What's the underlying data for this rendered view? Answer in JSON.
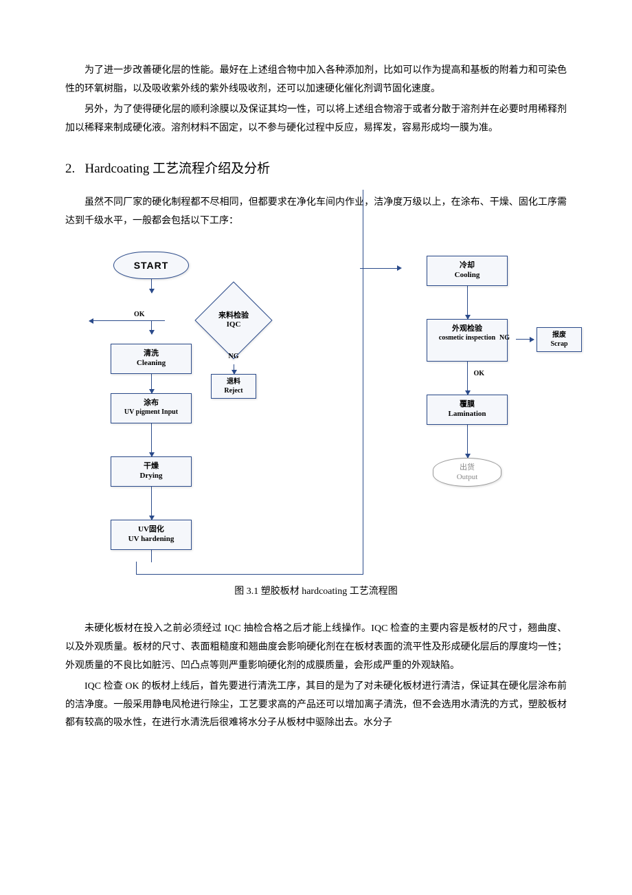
{
  "paragraphs": {
    "p1": "为了进一步改善硬化层的性能。最好在上述组合物中加入各种添加剂，比如可以作为提高和基板的附着力和可染色性的环氧树脂，以及吸收紫外线的紫外线吸收剂，还可以加速硬化催化剂调节固化速度。",
    "p2": "另外，为了使得硬化层的顺利涂膜以及保证其均一性，可以将上述组合物溶于或者分散于溶剂并在必要时用稀释剂加以稀释来制成硬化液。溶剂材料不固定，以不参与硬化过程中反应，易挥发，容易形成均一膜为准。",
    "p3": "虽然不同厂家的硬化制程都不尽相同，但都要求在净化车间内作业，洁净度万级以上，在涂布、干燥、固化工序需达到千级水平，一般都会包括以下工序：",
    "p4": "未硬化板材在投入之前必须经过 IQC 抽检合格之后才能上线操作。IQC 检查的主要内容是板材的尺寸，翘曲度、以及外观质量。板材的尺寸、表面粗糙度和翘曲度会影响硬化剂在在板材表面的流平性及形成硬化层后的厚度均一性；外观质量的不良比如脏污、凹凸点等则严重影响硬化剂的成膜质量，会形成严重的外观缺陷。",
    "p5": "IQC 检查 OK 的板材上线后，首先要进行清洗工序，其目的是为了对未硬化板材进行清洁，保证其在硬化层涂布前的洁净度。一般采用静电风枪进行除尘，工艺要求高的产品还可以增加离子清洗，但不会选用水清洗的方式，塑胶板材都有较高的吸水性，在进行水清洗后很难将水分子从板材中驱除出去。水分子"
  },
  "heading": {
    "num": "2.",
    "title": "Hardcoating 工艺流程介绍及分析"
  },
  "caption": "图 3.1    塑胶板材 hardcoating 工艺流程图",
  "flow": {
    "start": "START",
    "iqc": {
      "cn": "来料检验",
      "en": "IQC"
    },
    "ok": "OK",
    "ng": "NG",
    "reject": {
      "cn": "退料",
      "en": "Reject"
    },
    "cleaning": {
      "cn": "清洗",
      "en": "Cleaning"
    },
    "pigment": {
      "cn": "涂布",
      "en": "UV pigment Input"
    },
    "drying": {
      "cn": "干燥",
      "en": "Drying"
    },
    "uvharden": {
      "cn": "UV固化",
      "en": "UV hardening"
    },
    "cooling": {
      "cn": "冷却",
      "en": "Cooling"
    },
    "cosmetic": {
      "cn": "外观检验",
      "en": "cosmetic inspection"
    },
    "scrap": {
      "cn": "报废",
      "en": "Scrap"
    },
    "lamination": {
      "cn": "覆膜",
      "en": "Lamination"
    },
    "output": {
      "cn": "出货",
      "en": "Output"
    }
  }
}
